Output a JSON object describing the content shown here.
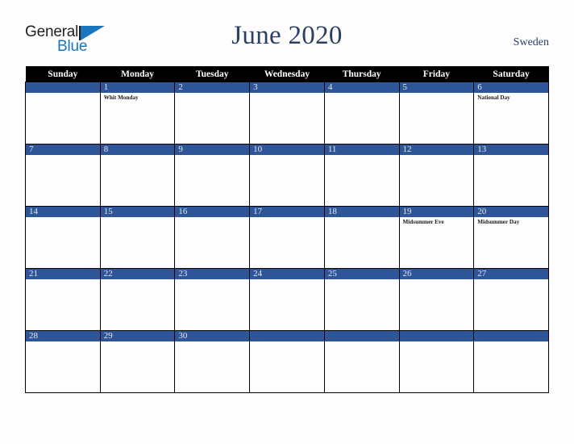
{
  "brand": {
    "top_text": "General",
    "bottom_text": "Blue",
    "flag_icon": "blue-triangle-flag-icon",
    "top_color": "#231f20",
    "bottom_color": "#1b75bc"
  },
  "header": {
    "title": "June 2020",
    "country": "Sweden",
    "title_color": "#2b3f63"
  },
  "theme": {
    "header_row_background": "#000000",
    "header_row_text": "#ffffff",
    "daynum_band_background": "#2e5597",
    "daynum_text": "#e8eaf0",
    "cell_background": "#fdfdfd",
    "grid_border": "#000000",
    "page_background": "#fdfdfd"
  },
  "calendar": {
    "month": "June",
    "year": "2020",
    "weekday_headers": [
      "Sunday",
      "Monday",
      "Tuesday",
      "Wednesday",
      "Thursday",
      "Friday",
      "Saturday"
    ],
    "weeks": [
      [
        {
          "day": "",
          "holiday": ""
        },
        {
          "day": "1",
          "holiday": "Whit Monday"
        },
        {
          "day": "2",
          "holiday": ""
        },
        {
          "day": "3",
          "holiday": ""
        },
        {
          "day": "4",
          "holiday": ""
        },
        {
          "day": "5",
          "holiday": ""
        },
        {
          "day": "6",
          "holiday": "National Day"
        }
      ],
      [
        {
          "day": "7",
          "holiday": ""
        },
        {
          "day": "8",
          "holiday": ""
        },
        {
          "day": "9",
          "holiday": ""
        },
        {
          "day": "10",
          "holiday": ""
        },
        {
          "day": "11",
          "holiday": ""
        },
        {
          "day": "12",
          "holiday": ""
        },
        {
          "day": "13",
          "holiday": ""
        }
      ],
      [
        {
          "day": "14",
          "holiday": ""
        },
        {
          "day": "15",
          "holiday": ""
        },
        {
          "day": "16",
          "holiday": ""
        },
        {
          "day": "17",
          "holiday": ""
        },
        {
          "day": "18",
          "holiday": ""
        },
        {
          "day": "19",
          "holiday": "Midsummer Eve"
        },
        {
          "day": "20",
          "holiday": "Midsummer Day"
        }
      ],
      [
        {
          "day": "21",
          "holiday": ""
        },
        {
          "day": "22",
          "holiday": ""
        },
        {
          "day": "23",
          "holiday": ""
        },
        {
          "day": "24",
          "holiday": ""
        },
        {
          "day": "25",
          "holiday": ""
        },
        {
          "day": "26",
          "holiday": ""
        },
        {
          "day": "27",
          "holiday": ""
        }
      ],
      [
        {
          "day": "28",
          "holiday": ""
        },
        {
          "day": "29",
          "holiday": ""
        },
        {
          "day": "30",
          "holiday": ""
        },
        {
          "day": "",
          "holiday": ""
        },
        {
          "day": "",
          "holiday": ""
        },
        {
          "day": "",
          "holiday": ""
        },
        {
          "day": "",
          "holiday": ""
        }
      ]
    ]
  }
}
